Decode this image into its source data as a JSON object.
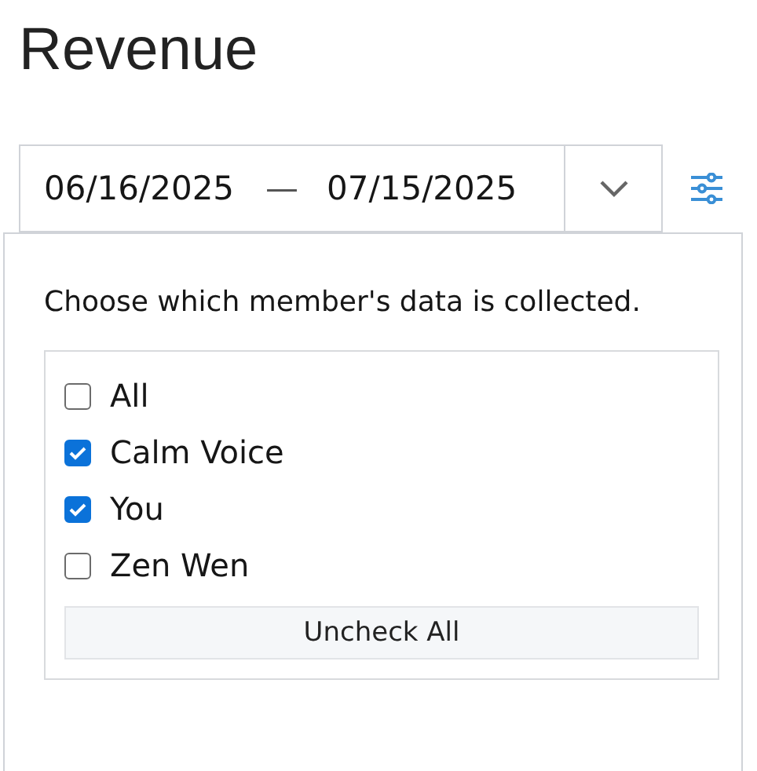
{
  "title": "Revenue",
  "date_range": {
    "start": "06/16/2025",
    "separator": "—",
    "end": "07/15/2025"
  },
  "popup": {
    "description": "Choose which member's data is collected.",
    "members": [
      {
        "label": "All",
        "checked": false
      },
      {
        "label": "Calm Voice",
        "checked": true
      },
      {
        "label": "You",
        "checked": true
      },
      {
        "label": "Zen Wen",
        "checked": false
      }
    ],
    "button": "Uncheck All"
  }
}
